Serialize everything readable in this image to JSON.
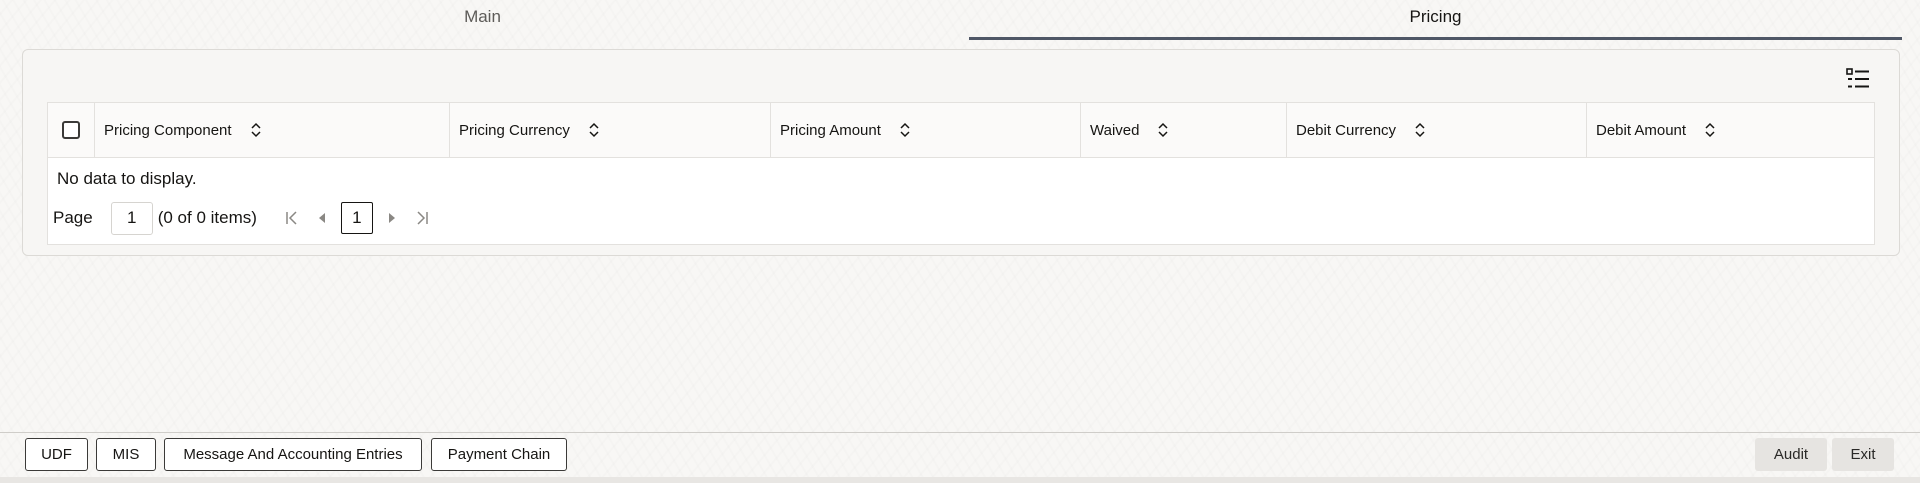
{
  "tabs": [
    {
      "label": "Main",
      "active": false
    },
    {
      "label": "Pricing",
      "active": true
    }
  ],
  "table": {
    "columns": [
      "Pricing Component",
      "Pricing Currency",
      "Pricing Amount",
      "Waived",
      "Debit Currency",
      "Debit Amount"
    ],
    "rows": [],
    "empty_message": "No data to display."
  },
  "pager": {
    "page_label": "Page",
    "page_value": "1",
    "count_text": "(0 of 0 items)",
    "current_page": "1"
  },
  "footer": {
    "udf": "UDF",
    "mis": "MIS",
    "message_accounting": "Message And Accounting Entries",
    "payment_chain": "Payment Chain",
    "audit": "Audit",
    "exit": "Exit"
  },
  "icons": {
    "column_list": "list-view-icon",
    "sort": "sort-icon",
    "first": "first-page-icon",
    "prev": "previous-page-icon",
    "next": "next-page-icon",
    "last": "last-page-icon"
  },
  "colors": {
    "active_tab_underline": "#4f5766",
    "background": "#f8f7f5"
  }
}
